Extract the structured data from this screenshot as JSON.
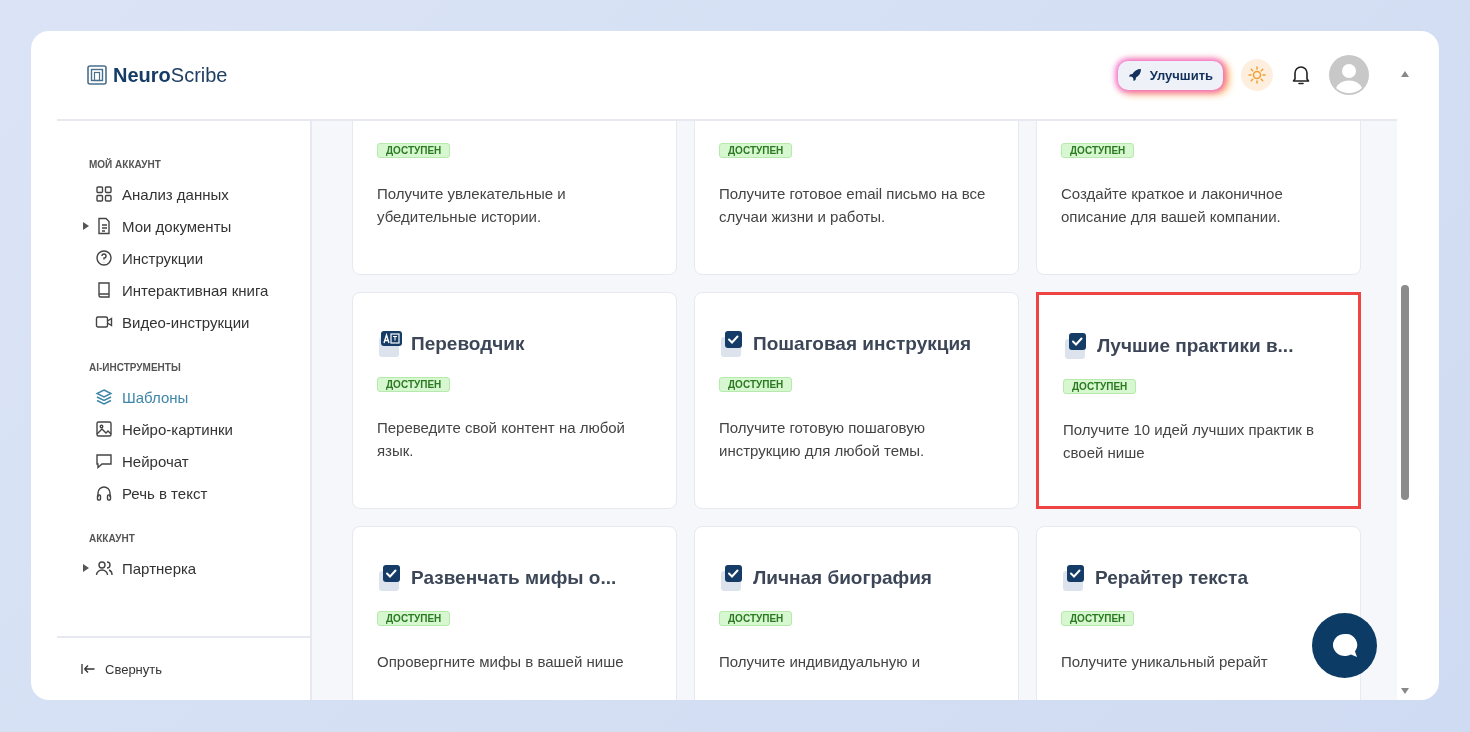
{
  "logo": {
    "bold": "Neuro",
    "regular": "Scribe"
  },
  "header": {
    "upgrade_button": "Улучшить"
  },
  "sidebar": {
    "sections": [
      {
        "heading": "МОЙ АККАУНТ",
        "items": [
          {
            "label": "Анализ данных",
            "kind": "link",
            "selected": false
          },
          {
            "label": "Мои документы",
            "kind": "group",
            "selected": false
          },
          {
            "label": "Инструкции",
            "kind": "link",
            "selected": false
          },
          {
            "label": "Интерактивная книга",
            "kind": "link",
            "selected": false
          },
          {
            "label": "Видео-инструкции",
            "kind": "link",
            "selected": false
          }
        ]
      },
      {
        "heading": "AI-ИНСТРУМЕНТЫ",
        "items": [
          {
            "label": "Шаблоны",
            "kind": "link",
            "selected": true
          },
          {
            "label": "Нейро-картинки",
            "kind": "link",
            "selected": false
          },
          {
            "label": "Нейрочат",
            "kind": "link",
            "selected": false
          },
          {
            "label": "Речь в текст",
            "kind": "link",
            "selected": false
          }
        ]
      },
      {
        "heading": "АККАУНТ",
        "items": [
          {
            "label": "Партнерка",
            "kind": "group",
            "selected": false
          }
        ]
      }
    ],
    "collapse": "Свернуть"
  },
  "cards": [
    {
      "badge": "ДОСТУПЕН",
      "description": "Получите увлекательные и убедительные истории.",
      "highlighted": false
    },
    {
      "badge": "ДОСТУПЕН",
      "description": "Получите готовое email письмо на все случаи жизни и работы.",
      "highlighted": false
    },
    {
      "badge": "ДОСТУПЕН",
      "description": "Создайте краткое и лаконичное описание для вашей компании.",
      "highlighted": false
    },
    {
      "kind": "translate",
      "title": "Переводчик",
      "badge": "ДОСТУПЕН",
      "description": "Переведите свой контент на любой язык.",
      "highlighted": false
    },
    {
      "kind": "check",
      "title": "Пошаговая инструкция",
      "badge": "ДОСТУПЕН",
      "description": "Получите готовую пошаговую инструкцию для любой темы.",
      "highlighted": false
    },
    {
      "kind": "check",
      "title": "Лучшие практики в...",
      "badge": "ДОСТУПЕН",
      "description": "Получите 10 идей лучших практик в своей нише",
      "highlighted": true
    },
    {
      "kind": "check",
      "title": "Развенчать мифы о...",
      "badge": "ДОСТУПЕН",
      "description": "Опровергните мифы в вашей нише",
      "highlighted": false
    },
    {
      "kind": "check",
      "title": "Личная биография",
      "badge": "ДОСТУПЕН",
      "description": "Получите индивидуальную и",
      "highlighted": false
    },
    {
      "kind": "check",
      "title": "Рерайтер текста",
      "badge": "ДОСТУПЕН",
      "description": "Получите уникальный рерайт",
      "highlighted": false
    }
  ]
}
